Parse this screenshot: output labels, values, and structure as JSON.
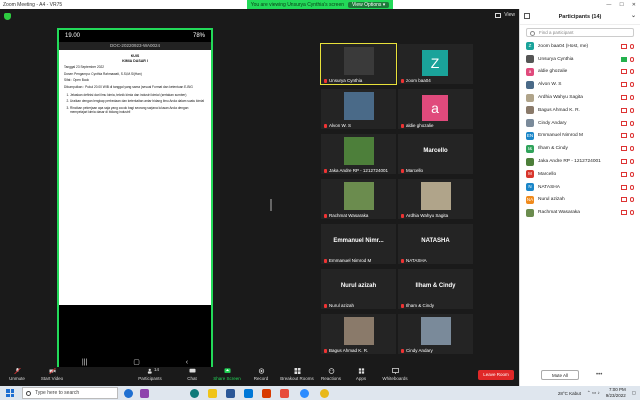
{
  "window": {
    "title": "Zoom Meeting - A4 - VR75"
  },
  "share": {
    "banner_text": "You are viewing Unsurya Cynthia's screen",
    "view_options": "View Options ▾"
  },
  "view_label": "View",
  "phone": {
    "time": "19.00",
    "battery": "78%",
    "doc_name": "DOC-20220923-WA0024",
    "paper": {
      "title_1": "KUIS",
      "title_2": "KIMIA DASAR I",
      "line_1": "Tanggal 23 September 2022",
      "line_2": "Dosen Pengampu: Cynthia Rahmawati, S.Si,M.Si(Han)",
      "line_3": "Sifat : Open Book",
      "line_4": "Dikumpulkan : Pukul 20.00 WIB di tanggal yang sama (sesuai Format dan ketentuan E-BIG",
      "q1": "Jelaskan definisi dari ilmu kimia, teknik kimia dan industri kimia! (sertakan sumber)",
      "q2": "Uraikan dengan lengkap perbedaan dan keterkaitan antar bidang ilmu Anda dalam suatu kimia!",
      "q3": "Rincikan pekerjaan apa saja yang cocok bagi seorang sarjana lulusan Anda dengan mempelajari kimia dasar di bidang industri!"
    }
  },
  "tiles": [
    {
      "name": "Unsurya Cynthia",
      "kind": "photo",
      "color": "#3a3a3a"
    },
    {
      "name": "zoom baa04",
      "kind": "letter",
      "letter": "Z",
      "color": "#1aa39a"
    },
    {
      "name": "Alvon W. S",
      "kind": "photo",
      "color": "#4a6a88"
    },
    {
      "name": "aldie ghozalie",
      "kind": "letter",
      "letter": "a",
      "color": "#e04a7c"
    },
    {
      "name": "Jaka Andre RP - 1212724001",
      "kind": "photo",
      "color": "#4d7f3a"
    },
    {
      "name": "Marcello",
      "kind": "big",
      "big": "Marcello"
    },
    {
      "name": "Rachmat Wasaraka",
      "kind": "photo",
      "color": "#6b8c4e"
    },
    {
      "name": "Ardhia Wahyu Sagita",
      "kind": "photo",
      "color": "#b0a48a"
    },
    {
      "name": "Emmanuel Nimrod M",
      "kind": "big",
      "big": "Emmanuel Nimr..."
    },
    {
      "name": "NATASHA",
      "kind": "big",
      "big": "NATASHA"
    },
    {
      "name": "Nurul azizah",
      "kind": "big",
      "big": "Nurul azizah"
    },
    {
      "name": "Ilham & Cindy",
      "kind": "big",
      "big": "Ilham & Cindy"
    },
    {
      "name": "Bagus Ahmad K. R.",
      "kind": "photo",
      "color": "#8a7a6a"
    },
    {
      "name": "Cindy Andary",
      "kind": "photo",
      "color": "#7a8a9a"
    }
  ],
  "toolbar": {
    "unmute": "Unmute",
    "start_video": "Start Video",
    "participants": "Participants",
    "participants_count": "14",
    "chat": "Chat",
    "share_screen": "Share Screen",
    "record": "Record",
    "breakout": "Breakout Rooms",
    "reactions": "Reactions",
    "apps": "Apps",
    "whiteboards": "Whiteboards",
    "leave": "Leave Room"
  },
  "panel": {
    "title": "Participants (14)",
    "search_placeholder": "Find a participant",
    "mute_all": "Mute All",
    "more": "•••",
    "participants": [
      {
        "name": "zoom baa04 (Host, me)",
        "initial": "Z",
        "color": "#1aa39a",
        "video_on": false
      },
      {
        "name": "Unsurya Cynthia",
        "initial": "",
        "color": "#555555",
        "video_on": true
      },
      {
        "name": "aldie ghozalie",
        "initial": "a",
        "color": "#e04a7c",
        "video_on": false
      },
      {
        "name": "Alvon W. S",
        "initial": "",
        "color": "#4a6a88",
        "video_on": false
      },
      {
        "name": "Ardhia Wahyu Sagita",
        "initial": "",
        "color": "#b0a48a",
        "video_on": false
      },
      {
        "name": "Bagus Ahmad K. R.",
        "initial": "",
        "color": "#8a7a6a",
        "video_on": false
      },
      {
        "name": "Cindy Andary",
        "initial": "",
        "color": "#7a8a9a",
        "video_on": false
      },
      {
        "name": "Emmanuel Nimrod M",
        "initial": "EN",
        "color": "#1a86c8",
        "video_on": false
      },
      {
        "name": "Ilham & Cindy",
        "initial": "I&",
        "color": "#2fa35a",
        "video_on": false
      },
      {
        "name": "Jaka Andre RP - 1212724001",
        "initial": "",
        "color": "#4d7f3a",
        "video_on": false
      },
      {
        "name": "Marcello",
        "initial": "M",
        "color": "#d8362c",
        "video_on": false
      },
      {
        "name": "NATASHA",
        "initial": "N",
        "color": "#1a86c8",
        "video_on": false
      },
      {
        "name": "Nurul azizah",
        "initial": "NA",
        "color": "#f08a1c",
        "video_on": false
      },
      {
        "name": "Rachmat Wasaraka",
        "initial": "",
        "color": "#6b8c4e",
        "video_on": false
      }
    ]
  },
  "taskbar": {
    "search_placeholder": "Type here to search",
    "weather": "28°C Kabut",
    "time": "7:00 PM",
    "date": "9/23/2022"
  }
}
